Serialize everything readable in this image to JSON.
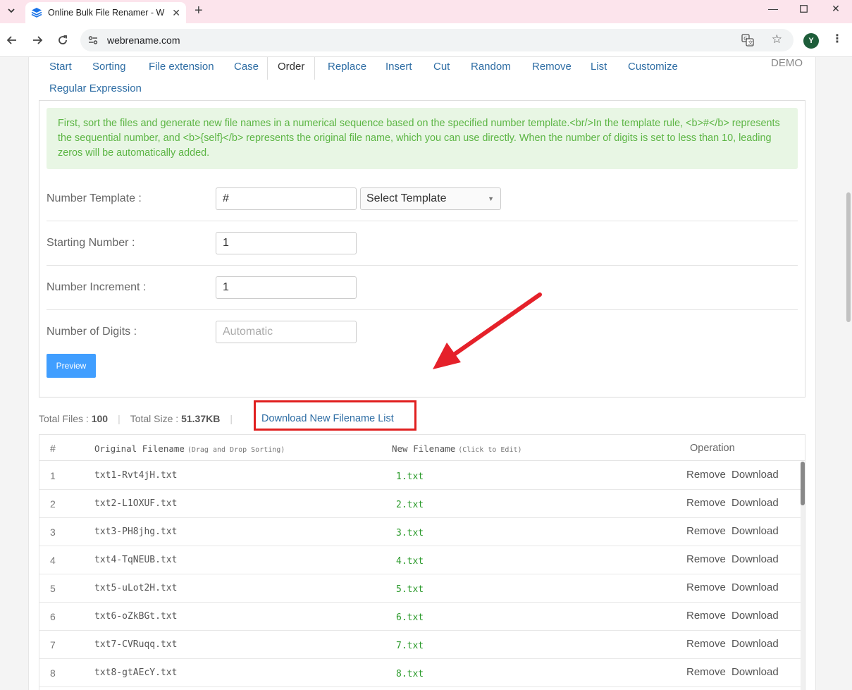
{
  "browser": {
    "tab_title": "Online Bulk File Renamer - W",
    "url": "webrename.com",
    "avatar_letter": "Y"
  },
  "nav": {
    "tabs": [
      "Start",
      "Sorting",
      "File extension",
      "Case",
      "Order",
      "Replace",
      "Insert",
      "Cut",
      "Random",
      "Remove",
      "List",
      "Customize"
    ],
    "tab_row2": "Regular Expression",
    "active_tab": "Order",
    "demo": "DEMO"
  },
  "info": {
    "text": "First, sort the files and generate new file names in a numerical sequence based on the specified number template.<br/>In the template rule, <b>#</b> represents the sequential number, and <b>{self}</b> represents the original file name, which you can use directly. When the number of digits is set to less than 10, leading zeros will be automatically added."
  },
  "form": {
    "template_label": "Number Template :",
    "template_value": "#",
    "template_select": "Select Template",
    "start_label": "Starting Number :",
    "start_value": "1",
    "increment_label": "Number Increment :",
    "increment_value": "1",
    "digits_label": "Number of Digits :",
    "digits_placeholder": "Automatic",
    "preview_button": "Preview"
  },
  "stats": {
    "total_files_label": "Total Files : ",
    "total_files": "100",
    "total_size_label": "Total Size : ",
    "total_size": "51.37KB",
    "download_list": "Download New Filename List"
  },
  "table": {
    "col_index": "#",
    "col_original": "Original Filename",
    "col_original_hint": "(Drag and Drop Sorting)",
    "col_new": "New Filename",
    "col_new_hint": "(Click to Edit)",
    "col_operation": "Operation",
    "remove_label": "Remove",
    "download_label": "Download",
    "rows": [
      {
        "index": "1",
        "original": "txt1-Rvt4jH.txt",
        "new": "1.txt"
      },
      {
        "index": "2",
        "original": "txt2-L1OXUF.txt",
        "new": "2.txt"
      },
      {
        "index": "3",
        "original": "txt3-PH8jhg.txt",
        "new": "3.txt"
      },
      {
        "index": "4",
        "original": "txt4-TqNEUB.txt",
        "new": "4.txt"
      },
      {
        "index": "5",
        "original": "txt5-uLot2H.txt",
        "new": "5.txt"
      },
      {
        "index": "6",
        "original": "txt6-oZkBGt.txt",
        "new": "6.txt"
      },
      {
        "index": "7",
        "original": "txt7-CVRuqq.txt",
        "new": "7.txt"
      },
      {
        "index": "8",
        "original": "txt8-gtAEcY.txt",
        "new": "8.txt"
      }
    ]
  }
}
